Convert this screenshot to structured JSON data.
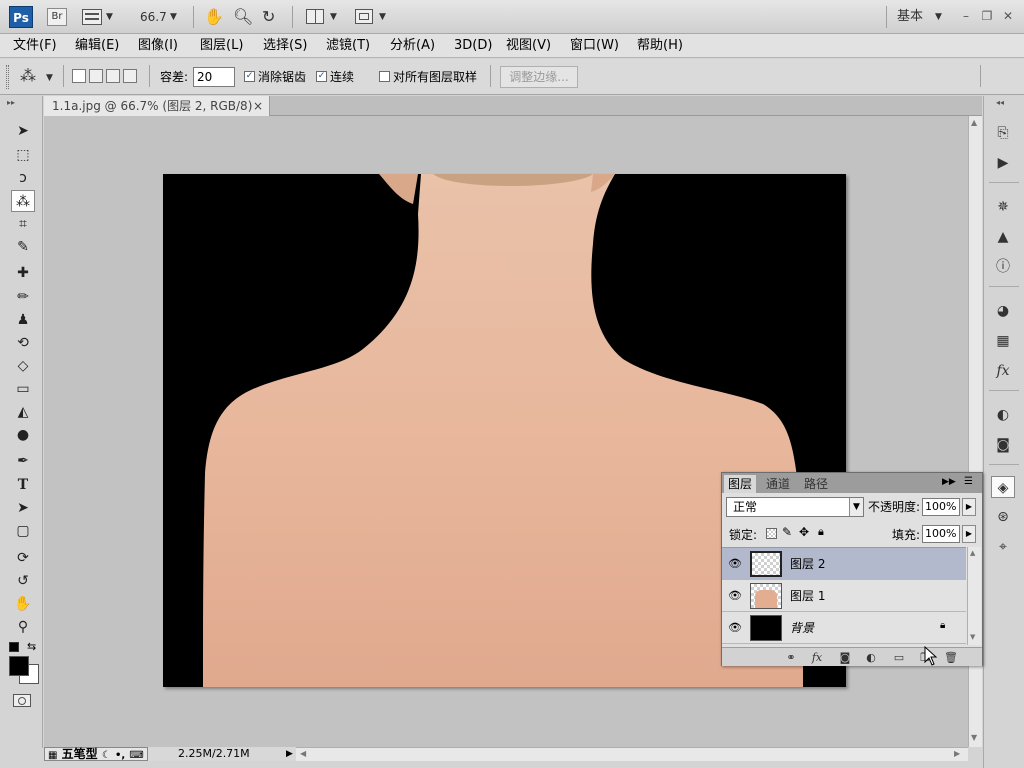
{
  "appbar": {
    "logo": "Ps",
    "bridge": "Br",
    "zoom": "66.7",
    "workspace": "基本",
    "icons": [
      "mini-bridge-icon",
      "zoom-icon",
      "hand-icon",
      "rotate-icon",
      "arrange-icon",
      "screen-mode-icon"
    ]
  },
  "menu": {
    "items": [
      "文件(F)",
      "编辑(E)",
      "图像(I)",
      "图层(L)",
      "选择(S)",
      "滤镜(T)",
      "分析(A)",
      "3D(D)",
      "视图(V)",
      "窗口(W)",
      "帮助(H)"
    ]
  },
  "options": {
    "tolerance_label": "容差:",
    "tolerance_value": "20",
    "antialias_label": "消除锯齿",
    "antialias_checked": true,
    "contiguous_label": "连续",
    "contiguous_checked": true,
    "sample_all_label": "对所有图层取样",
    "sample_all_checked": false,
    "refine_edge": "调整边缘..."
  },
  "document": {
    "tab_title": "1.1a.jpg @ 66.7% (图层 2, RGB/8) *",
    "close": "×"
  },
  "status": {
    "ime": "五笔型",
    "doc_size": "2.25M/2.71M"
  },
  "layers_panel": {
    "tabs": [
      "图层",
      "通道",
      "路径"
    ],
    "blend_mode": "正常",
    "opacity_label": "不透明度:",
    "opacity_value": "100%",
    "lock_label": "锁定:",
    "fill_label": "填充:",
    "fill_value": "100%",
    "layers": [
      {
        "name": "图层 2",
        "selected": true
      },
      {
        "name": "图层 1",
        "selected": false
      },
      {
        "name": "背景",
        "selected": false,
        "locked": true
      }
    ]
  },
  "colors": {
    "ps_blue": "#1f5fa8",
    "selected_layer": "#b3b9cc",
    "skin": "#e7b79b",
    "canvas_bg": "#c2c2c2"
  }
}
